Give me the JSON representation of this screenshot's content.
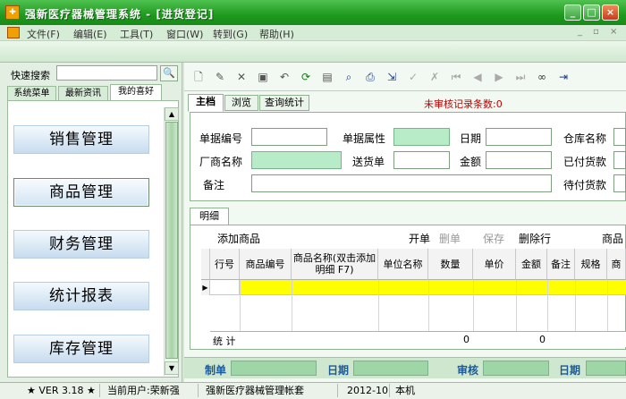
{
  "window": {
    "title": "强新医疗器械管理系统 - [进货登记]",
    "icon": "app-logo-icon"
  },
  "menu": {
    "items": [
      "文件(F)",
      "编辑(E)",
      "工具(T)",
      "窗口(W)",
      "转到(G)",
      "帮助(H)"
    ],
    "mdi_controls": [
      "_",
      "▫",
      "×"
    ]
  },
  "left": {
    "quick_search_label": "快速搜索",
    "quick_search_value": "",
    "search_button": "🔍",
    "tabs": [
      "系统菜单",
      "最新资讯",
      "我的喜好"
    ],
    "active_tab": "我的喜好",
    "nav_buttons": [
      "销售管理",
      "商品管理",
      "财务管理",
      "统计报表",
      "库存管理"
    ],
    "selected_nav": "商品管理"
  },
  "toolbar_icons": [
    "new-icon",
    "edit-icon",
    "delete-icon",
    "save-icon",
    "undo-icon",
    "refresh-icon",
    "print-preview-icon",
    "find-icon",
    "print-icon",
    "export-icon",
    "audit-icon",
    "unaudit-icon",
    "first-icon",
    "prev-icon",
    "next-icon",
    "last-icon",
    "binoculars-icon",
    "exit-icon"
  ],
  "record_tabs": [
    "主档",
    "浏览",
    "查询统计"
  ],
  "active_record_tab": "主档",
  "unaudited_text": "未审核记录条数:0",
  "form": {
    "bill_no_label": "单据编号",
    "bill_no": "",
    "bill_attr_label": "单据属性",
    "bill_attr": "",
    "date_label": "日期",
    "date": "",
    "warehouse_label": "仓库名称",
    "warehouse": "",
    "vendor_label": "厂商名称",
    "vendor": "",
    "delivery_label": "送货单",
    "delivery": "",
    "amount_label": "金额",
    "amount": "",
    "paid_label": "已付货款",
    "paid": "",
    "remark_label": "备注",
    "remark": "",
    "unpaid_label": "待付货款",
    "unpaid": ""
  },
  "detail": {
    "tab": "明细",
    "actions": {
      "add": "添加商品",
      "open": "开单",
      "delete": "删单",
      "save": "保存",
      "delete_row": "删除行",
      "more": "商品"
    },
    "columns": [
      "行号",
      "商品编号",
      "商品名称(双击添加明细 F7)",
      "单位名称",
      "数量",
      "单价",
      "金额",
      "备注",
      "规格",
      "商"
    ],
    "total_label": "统 计",
    "total_qty": "0",
    "total_amount": "0"
  },
  "footer": {
    "maker_label": "制单",
    "date_label": "日期",
    "auditor_label": "审核",
    "date2_label": "日期"
  },
  "status": {
    "version": "★ VER 3.18 ★",
    "user": "当前用户:荣新强",
    "account": "强新医疗器械管理帐套",
    "period": "2012-10",
    "machine": "本机"
  },
  "colors": {
    "title_green": "#1f9a1f",
    "field_green": "#b8ecc8",
    "row_yellow": "#ffff00",
    "alert_red": "#c00000"
  }
}
